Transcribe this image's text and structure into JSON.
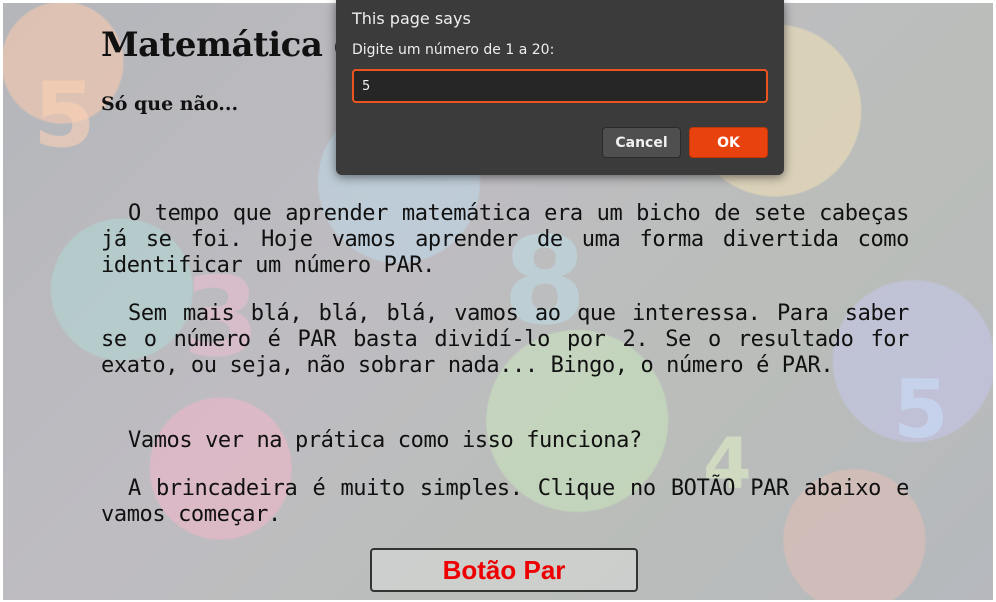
{
  "page": {
    "title": "Matemática é d",
    "subtitle": "Só que não...",
    "paragraphs": [
      "O tempo que aprender matemática era um bicho de sete cabeças já se foi. Hoje vamos aprender de uma forma divertida como identificar um número PAR.",
      "Sem mais blá, blá, blá, vamos ao que interessa. Para saber se o número é PAR basta dividí-lo por 2. Se o resultado for exato, ou seja, não sobrar nada... Bingo, o número é PAR.",
      "Vamos ver na prática como isso funciona?",
      "A brincadeira é muito simples. Clique no BOTÃO PAR abaixo e vamos começar."
    ],
    "button_label": "Botão Par",
    "button_color": "#ee0000"
  },
  "dialog": {
    "title": "This page says",
    "message": "Digite um número de 1 a 20:",
    "input_value": "5",
    "cancel_label": "Cancel",
    "ok_label": "OK",
    "accent_color": "#e8430e"
  }
}
